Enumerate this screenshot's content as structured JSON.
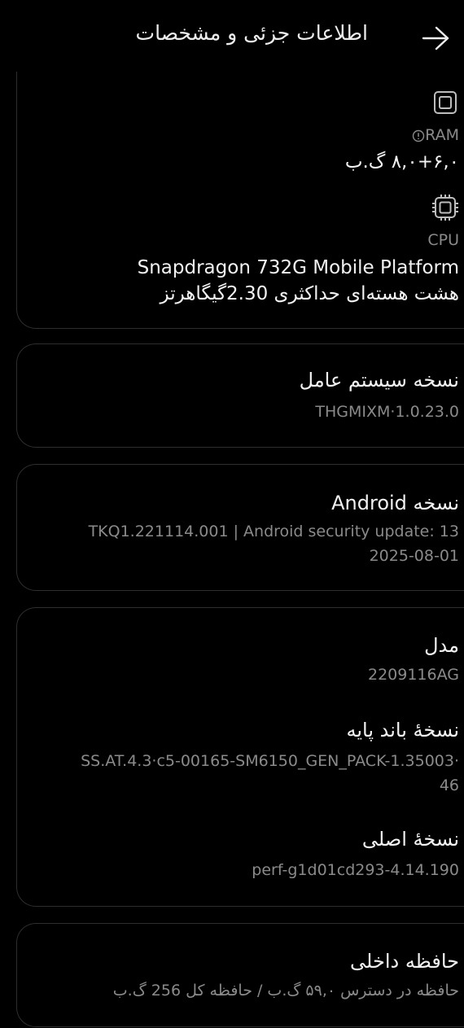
{
  "header": {
    "title": "اطلاعات جزئی و مشخصات",
    "back_icon": "arrow-right-icon"
  },
  "ram": {
    "icon": "chip-icon",
    "label": "RAM",
    "info_icon": "info-icon",
    "value": "۸,۰+۶,۰ گ.ب"
  },
  "cpu": {
    "icon": "chip-icon",
    "label": "CPU",
    "name": "Snapdragon 732G Mobile Platform",
    "detail": "هشت هسته‌ای حداکثری 2.30گیگاهرتز"
  },
  "os_version": {
    "label": "نسخه سیستم عامل",
    "value": "THGMIXM·1.0.23.0"
  },
  "android_version": {
    "label": "نسخه Android",
    "value_line1": "TKQ1.221114.001 | Android security update: 13",
    "value_line2": "2025-08-01"
  },
  "model": {
    "label": "مدل",
    "value": "2209116AG"
  },
  "baseband": {
    "label": "نسخهٔ باند پایه",
    "value_line1": "SS.AT.4.3·c5-00165-SM6150_GEN_PACK-1.35003·",
    "value_line2": "46"
  },
  "kernel": {
    "label": "نسخهٔ اصلی",
    "value": "perf-g1d01cd293-4.14.190"
  },
  "storage": {
    "label": "حافظه داخلی",
    "value": "حافظه در دسترس  ۵۹,۰ گ.ب / حافظه کل  256 گ.ب"
  }
}
